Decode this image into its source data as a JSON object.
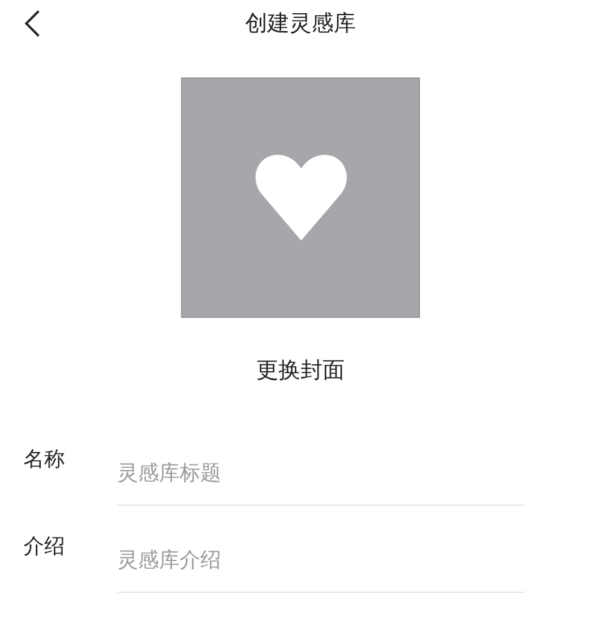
{
  "header": {
    "title": "创建灵感库"
  },
  "cover": {
    "button": "更换封面"
  },
  "fields": [
    {
      "label": "名称",
      "placeholder": "灵感库标题"
    },
    {
      "label": "介绍",
      "placeholder": "灵感库介绍"
    }
  ]
}
